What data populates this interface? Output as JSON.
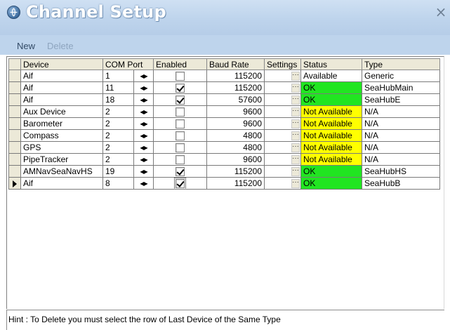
{
  "window": {
    "title": "Channel Setup",
    "close_glyph": "×"
  },
  "toolbar": {
    "new_label": "New",
    "delete_label": "Delete"
  },
  "grid": {
    "columns": [
      "Device",
      "COM Port",
      "Enabled",
      "Baud Rate",
      "Settings",
      "Status",
      "Type"
    ],
    "settings_glyph": "···",
    "arrows_glyph": "◀▶",
    "rows": [
      {
        "device": "Aif",
        "com_port": "1",
        "enabled": false,
        "baud_rate": "115200",
        "status": "Available",
        "status_kind": "available",
        "type": "Generic",
        "current": false
      },
      {
        "device": "Aif",
        "com_port": "11",
        "enabled": true,
        "baud_rate": "115200",
        "status": "OK",
        "status_kind": "ok",
        "type": "SeaHubMain",
        "current": false
      },
      {
        "device": "Aif",
        "com_port": "18",
        "enabled": true,
        "baud_rate": "57600",
        "status": "OK",
        "status_kind": "ok",
        "type": "SeaHubE",
        "current": false
      },
      {
        "device": "Aux Device",
        "com_port": "2",
        "enabled": false,
        "baud_rate": "9600",
        "status": "Not Available",
        "status_kind": "na",
        "type": "N/A",
        "current": false
      },
      {
        "device": "Barometer",
        "com_port": "2",
        "enabled": false,
        "baud_rate": "9600",
        "status": "Not Available",
        "status_kind": "na",
        "type": "N/A",
        "current": false
      },
      {
        "device": "Compass",
        "com_port": "2",
        "enabled": false,
        "baud_rate": "4800",
        "status": "Not Available",
        "status_kind": "na",
        "type": "N/A",
        "current": false
      },
      {
        "device": "GPS",
        "com_port": "2",
        "enabled": false,
        "baud_rate": "4800",
        "status": "Not Available",
        "status_kind": "na",
        "type": "N/A",
        "current": false
      },
      {
        "device": "PipeTracker",
        "com_port": "2",
        "enabled": false,
        "baud_rate": "9600",
        "status": "Not Available",
        "status_kind": "na",
        "type": "N/A",
        "current": false
      },
      {
        "device": "AMNavSeaNavHS",
        "com_port": "19",
        "enabled": true,
        "baud_rate": "115200",
        "status": "OK",
        "status_kind": "ok",
        "type": "SeaHubHS",
        "current": false
      },
      {
        "device": "Aif",
        "com_port": "8",
        "enabled": true,
        "baud_rate": "115200",
        "status": "OK",
        "status_kind": "ok",
        "type": "SeaHubB",
        "current": true
      }
    ]
  },
  "statusbar": {
    "hint": "Hint : To Delete you must select the row of Last Device of the Same Type"
  },
  "colors": {
    "status_ok": "#21e521",
    "status_not_available": "#ffff00",
    "titlebar": "#bed4ec"
  },
  "icons": {
    "title_icon": "channel-setup-globe-icon",
    "close": "close-icon",
    "row_indicator": "current-row-arrow-icon",
    "com_port_spinner": "left-right-spinner-icon",
    "settings": "ellipsis-icon"
  }
}
